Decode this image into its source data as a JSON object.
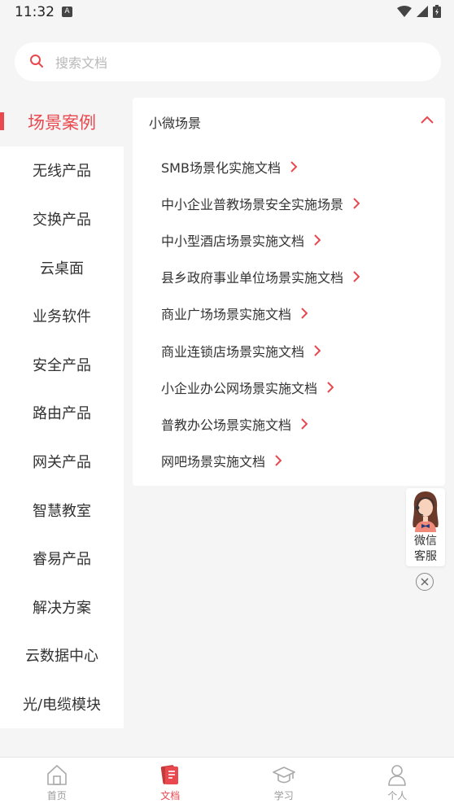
{
  "status": {
    "time": "11:32"
  },
  "search": {
    "placeholder": "搜索文档"
  },
  "sidebar": {
    "items": [
      {
        "label": "场景案例",
        "active": true
      },
      {
        "label": "无线产品"
      },
      {
        "label": "交换产品"
      },
      {
        "label": "云桌面"
      },
      {
        "label": "业务软件"
      },
      {
        "label": "安全产品"
      },
      {
        "label": "路由产品"
      },
      {
        "label": "网关产品"
      },
      {
        "label": "智慧教室"
      },
      {
        "label": "睿易产品"
      },
      {
        "label": "解决方案"
      },
      {
        "label": "云数据中心"
      },
      {
        "label": "光/电缆模块"
      }
    ]
  },
  "content": {
    "section_title": "小微场景",
    "documents": [
      "SMB场景化实施文档",
      "中小企业普教场景安全实施场景",
      "中小型酒店场景实施文档",
      "县乡政府事业单位场景实施文档",
      "商业广场场景实施文档",
      "商业连锁店场景实施文档",
      "小企业办公网场景实施文档",
      "普教办公场景实施文档",
      "网吧场景实施文档"
    ]
  },
  "service": {
    "line1": "微信",
    "line2": "客服"
  },
  "bottomnav": {
    "items": [
      {
        "label": "首页",
        "icon": "home-icon"
      },
      {
        "label": "文档",
        "icon": "document-icon",
        "active": true
      },
      {
        "label": "学习",
        "icon": "graduation-cap-icon"
      },
      {
        "label": "个人",
        "icon": "person-icon"
      }
    ]
  },
  "colors": {
    "accent": "#e8484e",
    "background": "#f5f5f5"
  }
}
